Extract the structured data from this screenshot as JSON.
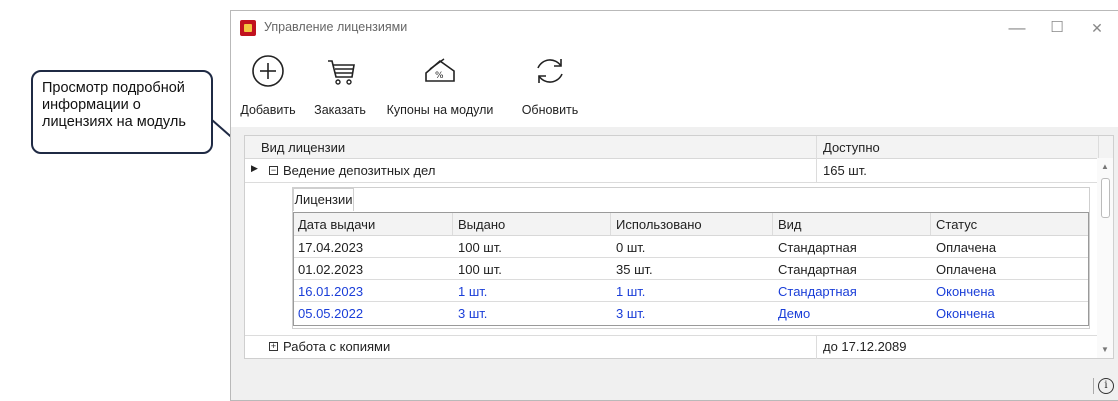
{
  "callout": {
    "text_lines": [
      "Просмотр подробной",
      "информации о",
      "лицензиях на модуль"
    ]
  },
  "window": {
    "title": "Управление лицензиями",
    "controls": {
      "minimize": "—",
      "maximize": "☐",
      "close": "✕"
    }
  },
  "toolbar": {
    "add": "Добавить",
    "order": "Заказать",
    "coupons": "Купоны на модули",
    "refresh": "Обновить"
  },
  "grid": {
    "columns": {
      "type": "Вид лицензии",
      "available": "Доступно"
    },
    "rows": [
      {
        "name": "Ведение депозитных дел",
        "available": "165 шт.",
        "expanded": true
      },
      {
        "name": "Работа с копиями",
        "available": "до 17.12.2089",
        "expanded": false
      }
    ]
  },
  "detail": {
    "tab": "Лицензии",
    "columns": [
      "Дата выдачи",
      "Выдано",
      "Использовано",
      "Вид",
      "Статус"
    ],
    "rows": [
      [
        "17.04.2023",
        "100 шт.",
        "0 шт.",
        "Стандартная",
        "Оплачена"
      ],
      [
        "01.02.2023",
        "100 шт.",
        "35 шт.",
        "Стандартная",
        "Оплачена"
      ],
      [
        "16.01.2023",
        "1 шт.",
        "1 шт.",
        "Стандартная",
        "Окончена"
      ],
      [
        "05.05.2022",
        "3 шт.",
        "3 шт.",
        "Демо",
        "Окончена"
      ]
    ]
  },
  "status": {
    "info_icon": "i"
  },
  "colors": {
    "expired_text": "#1a3ed8",
    "accent_icon": "#c1121f"
  }
}
